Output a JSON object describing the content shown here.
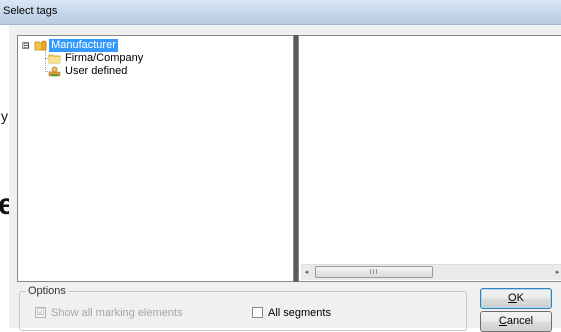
{
  "window": {
    "title": "Select tags"
  },
  "background_text": {
    "small": "y",
    "large": "e"
  },
  "tree": {
    "expander_symbol": "⊟",
    "items": [
      {
        "label": "Manufacturer",
        "icon": "database-folder-icon",
        "selected": true
      },
      {
        "label": "Firma/Company",
        "icon": "folder-icon",
        "selected": false
      },
      {
        "label": "User defined",
        "icon": "user-icon",
        "selected": false
      }
    ]
  },
  "scrollbar": {
    "left_arrow": "◂",
    "right_arrow": "▸",
    "grip": "III"
  },
  "options": {
    "legend": "Options",
    "show_all_marking_elements": {
      "label": "Show all marking elements",
      "checked": true,
      "enabled": false,
      "check_glyph": "☑"
    },
    "all_segments": {
      "label": "All segments",
      "checked": false,
      "enabled": true
    }
  },
  "buttons": {
    "ok": {
      "mnemonic": "O",
      "rest": "K"
    },
    "cancel": {
      "mnemonic": "C",
      "rest": "ancel"
    }
  },
  "colors": {
    "selection": "#3399ff",
    "dialog_bg": "#f0f0f0",
    "splitter": "#5a5a5a"
  }
}
